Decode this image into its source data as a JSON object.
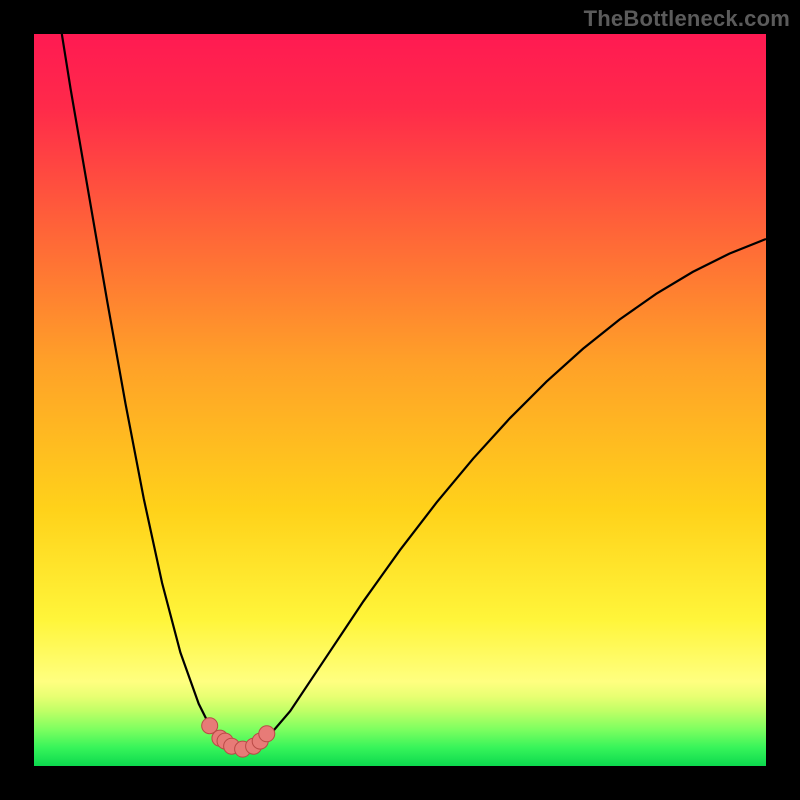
{
  "watermark": "TheBottleneck.com",
  "colors": {
    "frame": "#000000",
    "gradient_stops": [
      {
        "offset": 0.0,
        "color": "#ff1a52"
      },
      {
        "offset": 0.1,
        "color": "#ff2a4a"
      },
      {
        "offset": 0.25,
        "color": "#ff5e3a"
      },
      {
        "offset": 0.45,
        "color": "#ffa128"
      },
      {
        "offset": 0.65,
        "color": "#ffd21a"
      },
      {
        "offset": 0.8,
        "color": "#fff53a"
      },
      {
        "offset": 0.885,
        "color": "#ffff80"
      },
      {
        "offset": 0.905,
        "color": "#e8ff72"
      },
      {
        "offset": 0.925,
        "color": "#bfff66"
      },
      {
        "offset": 0.95,
        "color": "#7dff60"
      },
      {
        "offset": 0.975,
        "color": "#37f45a"
      },
      {
        "offset": 1.0,
        "color": "#0cd94e"
      }
    ],
    "curve": "#000000",
    "marker_fill": "#e77b77",
    "marker_stroke": "#b94a46"
  },
  "chart_data": {
    "type": "line",
    "title": "",
    "xlabel": "",
    "ylabel": "",
    "xlim": [
      0,
      100
    ],
    "ylim": [
      0,
      100
    ],
    "grid": false,
    "series": [
      {
        "name": "left-branch",
        "x": [
          3.8,
          5.0,
          7.5,
          10.0,
          12.5,
          15.0,
          17.5,
          20.0,
          22.5,
          24.0,
          25.4,
          26.1
        ],
        "values": [
          100,
          92.5,
          78.0,
          63.5,
          49.5,
          36.5,
          25.0,
          15.5,
          8.5,
          5.5,
          3.8,
          3.4
        ]
      },
      {
        "name": "right-branch",
        "x": [
          30.9,
          32.0,
          35.0,
          40.0,
          45.0,
          50.0,
          55.0,
          60.0,
          65.0,
          70.0,
          75.0,
          80.0,
          85.0,
          90.0,
          95.0,
          100.0
        ],
        "values": [
          3.4,
          4.0,
          7.5,
          15.0,
          22.5,
          29.5,
          36.0,
          42.0,
          47.5,
          52.5,
          57.0,
          61.0,
          64.5,
          67.5,
          70.0,
          72.0
        ]
      },
      {
        "name": "valley-floor",
        "x": [
          26.1,
          27.0,
          28.0,
          29.0,
          30.0,
          30.9
        ],
        "values": [
          3.4,
          2.7,
          2.4,
          2.4,
          2.7,
          3.4
        ]
      }
    ],
    "markers": {
      "name": "valley-points",
      "x": [
        24.0,
        25.4,
        26.1,
        27.0,
        28.5,
        30.0,
        30.9,
        31.8
      ],
      "values": [
        5.5,
        3.8,
        3.4,
        2.7,
        2.3,
        2.7,
        3.4,
        4.4
      ]
    }
  }
}
